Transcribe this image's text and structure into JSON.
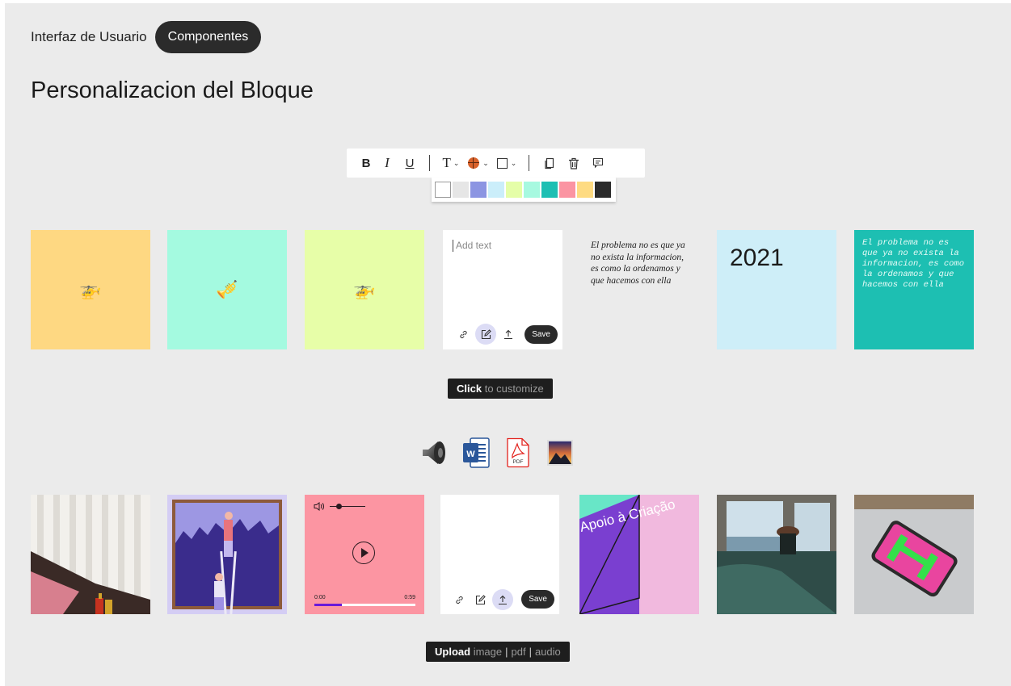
{
  "breadcrumb": {
    "parent": "Interfaz de Usuario",
    "current": "Componentes"
  },
  "title": "Personalizacion del Bloque",
  "toolbar": {
    "bold": "B",
    "italic": "I",
    "underline": "U",
    "text_type": "T",
    "icons": [
      "bold-icon",
      "italic-icon",
      "underline-icon",
      "text-type-icon",
      "color-icon",
      "border-icon",
      "copy-icon",
      "trash-icon",
      "comment-icon"
    ]
  },
  "palette": [
    "#ffffff",
    "#e6e6e6",
    "#8c95e2",
    "#cbeefa",
    "#e5fea8",
    "#a7f9e0",
    "#1ebfb3",
    "#fb94a2",
    "#fedb82",
    "#2b2b2b"
  ],
  "row1": [
    {
      "type": "emoji",
      "bg": "#fed882",
      "emoji": "🚁"
    },
    {
      "type": "emoji",
      "bg": "#a4fae0",
      "emoji": "🎺"
    },
    {
      "type": "emoji",
      "bg": "#e7fea8",
      "emoji": "🚁"
    },
    {
      "type": "editor",
      "bg": "#ffffff",
      "placeholder": "Add text",
      "save": "Save"
    },
    {
      "type": "quote",
      "bg": "#ebebeb",
      "text": "El problema no es que ya no exista la informacion,  es como la ordenamos y que hacemos con ella"
    },
    {
      "type": "year",
      "bg": "#ceeef8",
      "text": "2021"
    },
    {
      "type": "mono",
      "bg": "#1dbfb2",
      "text": "El problema no es que ya no exista la informacion, es como la ordenamos y que hacemos con ella"
    }
  ],
  "tooltip1": {
    "bold": "Click",
    "rest": "to customize"
  },
  "filetypes": [
    "speaker-icon",
    "word-file-icon",
    "pdf-file-icon",
    "image-file-icon"
  ],
  "pdf_label": "PDF",
  "word_label": "W",
  "row2": {
    "audio": {
      "bg": "#fc95a2",
      "time_start": "0:00",
      "time_end": "0:59",
      "progress": 0.27
    },
    "editor": {
      "save": "Save"
    },
    "poster_text": "Apoio à Criação"
  },
  "tooltip2": {
    "bold": "Upload",
    "parts": [
      "image",
      "pdf",
      "audio"
    ]
  }
}
